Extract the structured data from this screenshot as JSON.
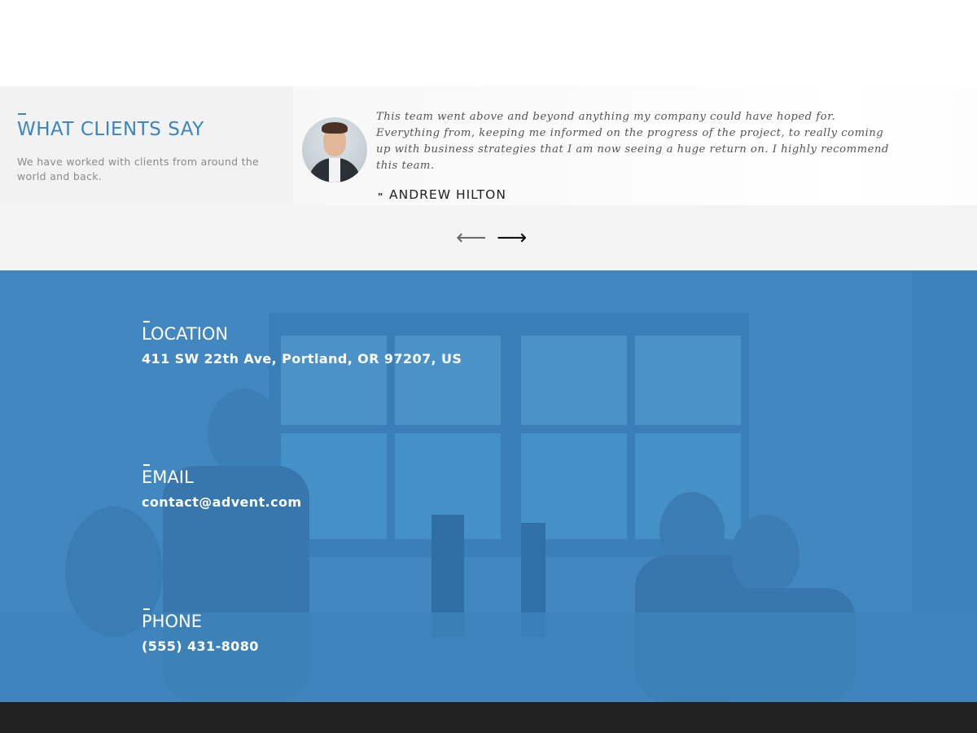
{
  "testimonials": {
    "heading": "WHAT CLIENTS SAY",
    "subheading": "We have worked with clients from around the world and back.",
    "quote": "This team went above and beyond anything my company could have hoped for. Everything from, keeping me informed on the progress of the project, to really coming up with business strategies that I am now seeing a huge return on. I highly recommend this team.",
    "author_mark": "\"",
    "author": "ANDREW HILTON",
    "prev_arrow": "⟵",
    "next_arrow": "⟶"
  },
  "contact": {
    "location": {
      "title": "LOCATION",
      "value": "411 SW 22th Ave, Portland, OR 97207, US"
    },
    "email": {
      "title": "EMAIL",
      "value": "contact@advent.com"
    },
    "phone": {
      "title": "PHONE",
      "value": "(555) 431-8080"
    }
  },
  "colors": {
    "accent_blue": "#3b85c1",
    "contact_overlay": "#4287c0",
    "footer": "#222222"
  },
  "icons": {
    "prev": "arrow-left-icon",
    "next": "arrow-right-icon"
  }
}
